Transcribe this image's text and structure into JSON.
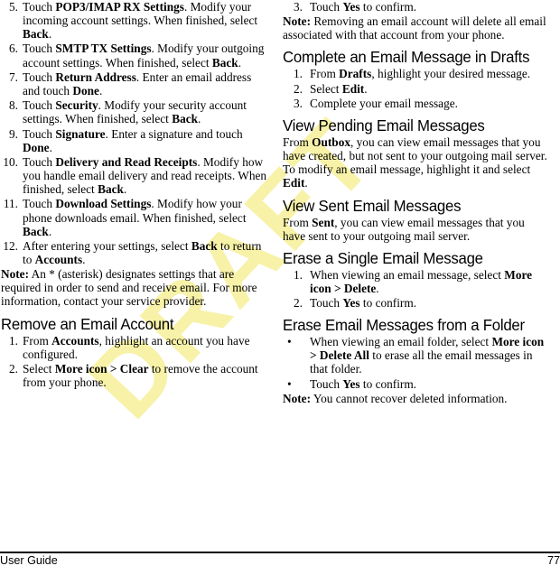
{
  "document": {
    "footer": {
      "left_label": "User Guide",
      "page_number": "77"
    },
    "watermark": {
      "text": "DRAFT",
      "color": "#f7f2a8"
    }
  },
  "left_column": {
    "continued_steps": [
      {
        "number": "5.",
        "segments": [
          {
            "text": "Touch ",
            "bold": false
          },
          {
            "text": "POP3/IMAP RX Settings",
            "bold": true
          },
          {
            "text": ". Modify your incoming account settings. When finished, select ",
            "bold": false
          },
          {
            "text": "Back",
            "bold": true
          },
          {
            "text": ".",
            "bold": false
          }
        ]
      },
      {
        "number": "6.",
        "segments": [
          {
            "text": "Touch ",
            "bold": false
          },
          {
            "text": "SMTP TX Settings",
            "bold": true
          },
          {
            "text": ". Modify your outgoing account settings. When finished, select ",
            "bold": false
          },
          {
            "text": "Back",
            "bold": true
          },
          {
            "text": ".",
            "bold": false
          }
        ]
      },
      {
        "number": "7.",
        "segments": [
          {
            "text": "Touch ",
            "bold": false
          },
          {
            "text": "Return Address",
            "bold": true
          },
          {
            "text": ". Enter an email address and touch ",
            "bold": false
          },
          {
            "text": "Done",
            "bold": true
          },
          {
            "text": ".",
            "bold": false
          }
        ]
      },
      {
        "number": "8.",
        "segments": [
          {
            "text": "Touch ",
            "bold": false
          },
          {
            "text": "Security",
            "bold": true
          },
          {
            "text": ". Modify your security account settings. When finished, select ",
            "bold": false
          },
          {
            "text": "Back",
            "bold": true
          },
          {
            "text": ".",
            "bold": false
          }
        ]
      },
      {
        "number": "9.",
        "segments": [
          {
            "text": "Touch ",
            "bold": false
          },
          {
            "text": "Signature",
            "bold": true
          },
          {
            "text": ". Enter a signature and touch ",
            "bold": false
          },
          {
            "text": "Done",
            "bold": true
          },
          {
            "text": ".",
            "bold": false
          }
        ]
      },
      {
        "number": "10.",
        "segments": [
          {
            "text": "Touch ",
            "bold": false
          },
          {
            "text": "Delivery and Read Receipts",
            "bold": true
          },
          {
            "text": ". Modify how you handle email delivery and read receipts. When finished, select ",
            "bold": false
          },
          {
            "text": "Back",
            "bold": true
          },
          {
            "text": ".",
            "bold": false
          }
        ]
      },
      {
        "number": "11.",
        "segments": [
          {
            "text": "Touch ",
            "bold": false
          },
          {
            "text": "Download Settings",
            "bold": true
          },
          {
            "text": ". Modify how your phone downloads email. When finished, select ",
            "bold": false
          },
          {
            "text": "Back",
            "bold": true
          },
          {
            "text": ".",
            "bold": false
          }
        ]
      },
      {
        "number": "12.",
        "segments": [
          {
            "text": "After entering your settings, select ",
            "bold": false
          },
          {
            "text": "Back",
            "bold": true
          },
          {
            "text": " to return to ",
            "bold": false
          },
          {
            "text": "Accounts",
            "bold": true
          },
          {
            "text": ".",
            "bold": false
          }
        ]
      }
    ],
    "note_asterisk": {
      "segments": [
        {
          "text": "Note:",
          "bold": true
        },
        {
          "text": " An * (asterisk) designates settings that are required in order to send and receive email. For more information, contact your service provider.",
          "bold": false
        }
      ]
    },
    "section_remove_account": {
      "heading": "Remove an Email Account",
      "steps": [
        {
          "number": "1.",
          "segments": [
            {
              "text": "From ",
              "bold": false
            },
            {
              "text": "Accounts",
              "bold": true
            },
            {
              "text": ", highlight an account you have configured.",
              "bold": false
            }
          ]
        },
        {
          "number": "2.",
          "segments": [
            {
              "text": "Select ",
              "bold": false
            },
            {
              "text": "More icon > Clear",
              "bold": true
            },
            {
              "text": " to remove the account from your phone.",
              "bold": false
            }
          ]
        }
      ]
    }
  },
  "right_column": {
    "continued_steps": [
      {
        "number": "3.",
        "segments": [
          {
            "text": "Touch ",
            "bold": false
          },
          {
            "text": "Yes",
            "bold": true
          },
          {
            "text": " to confirm.",
            "bold": false
          }
        ]
      }
    ],
    "note_removing": {
      "segments": [
        {
          "text": "Note:",
          "bold": true
        },
        {
          "text": " Removing an email account will delete all email associated with that account from your phone.",
          "bold": false
        }
      ]
    },
    "section_complete_draft": {
      "heading": "Complete an Email Message in Drafts",
      "steps": [
        {
          "number": "1.",
          "segments": [
            {
              "text": "From ",
              "bold": false
            },
            {
              "text": "Drafts",
              "bold": true
            },
            {
              "text": ", highlight your desired message.",
              "bold": false
            }
          ]
        },
        {
          "number": "2.",
          "segments": [
            {
              "text": "Select ",
              "bold": false
            },
            {
              "text": "Edit",
              "bold": true
            },
            {
              "text": ".",
              "bold": false
            }
          ]
        },
        {
          "number": "3.",
          "segments": [
            {
              "text": "Complete your email message.",
              "bold": false
            }
          ]
        }
      ]
    },
    "section_view_pending": {
      "heading": "View Pending Email Messages",
      "paragraph": [
        {
          "text": "From ",
          "bold": false
        },
        {
          "text": "Outbox",
          "bold": true
        },
        {
          "text": ", you can view email messages that you have created, but not sent to your outgoing mail server. To modify an email message, highlight it and select ",
          "bold": false
        },
        {
          "text": "Edit",
          "bold": true
        },
        {
          "text": ".",
          "bold": false
        }
      ]
    },
    "section_view_sent": {
      "heading": "View Sent Email Messages",
      "paragraph": [
        {
          "text": "From ",
          "bold": false
        },
        {
          "text": "Sent",
          "bold": true
        },
        {
          "text": ", you can view email messages that you have sent to your outgoing mail server.",
          "bold": false
        }
      ]
    },
    "section_erase_single": {
      "heading": "Erase a Single Email Message",
      "steps": [
        {
          "number": "1.",
          "segments": [
            {
              "text": "When viewing an email message, select ",
              "bold": false
            },
            {
              "text": "More icon > Delete",
              "bold": true
            },
            {
              "text": ".",
              "bold": false
            }
          ]
        },
        {
          "number": "2.",
          "segments": [
            {
              "text": "Touch ",
              "bold": false
            },
            {
              "text": "Yes",
              "bold": true
            },
            {
              "text": " to confirm.",
              "bold": false
            }
          ]
        }
      ]
    },
    "section_erase_folder": {
      "heading": "Erase Email Messages from a Folder",
      "bullet_glyph": "•",
      "bullets": [
        {
          "segments": [
            {
              "text": "When viewing an email folder, select ",
              "bold": false
            },
            {
              "text": "More icon > Delete All",
              "bold": true
            },
            {
              "text": " to erase all the email messages in that folder.",
              "bold": false
            }
          ]
        },
        {
          "segments": [
            {
              "text": "Touch ",
              "bold": false
            },
            {
              "text": "Yes",
              "bold": true
            },
            {
              "text": " to confirm.",
              "bold": false
            }
          ]
        }
      ],
      "note": {
        "segments": [
          {
            "text": "Note:",
            "bold": true
          },
          {
            "text": " You cannot recover deleted information.",
            "bold": false
          }
        ]
      }
    }
  }
}
